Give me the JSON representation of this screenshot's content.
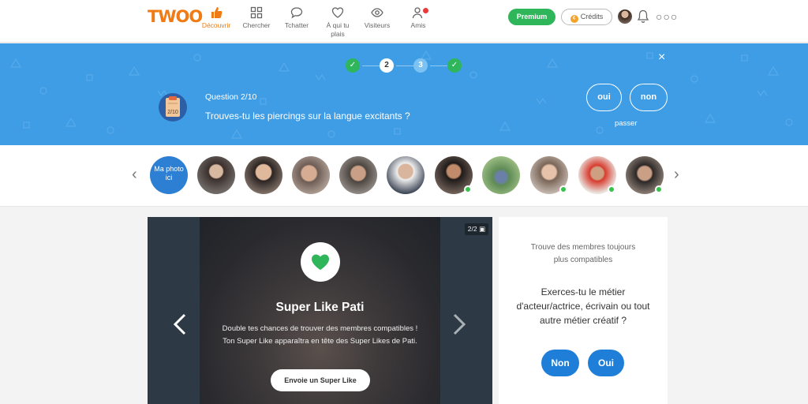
{
  "brand": {
    "logo": "TWOO",
    "accent": "#f07a13"
  },
  "nav": {
    "items": [
      {
        "label": "Découvrir",
        "icon": "thumbs-up-icon",
        "active": true
      },
      {
        "label": "Chercher",
        "icon": "grid-icon"
      },
      {
        "label": "Tchatter",
        "icon": "chat-bubble-icon"
      },
      {
        "label": "À qui tu plais",
        "icon": "heart-outline-icon"
      },
      {
        "label": "Visiteurs",
        "icon": "eye-icon"
      },
      {
        "label": "Amis",
        "icon": "friends-icon",
        "has_notification": true
      }
    ],
    "premium_label": "Premium",
    "credits_label": "Crédits",
    "more_label": "○○○"
  },
  "quiz": {
    "steps": [
      "✓",
      "2",
      "3",
      "✓"
    ],
    "question_label": "Question 2/10",
    "question_badge": "2/10",
    "question_text": "Trouves-tu les piercings sur la langue excitants ?",
    "yes_label": "oui",
    "no_label": "non",
    "skip_label": "passer",
    "close_label": "×"
  },
  "strip": {
    "my_photo_label": "Ma photo ici",
    "online_flags": [
      false,
      false,
      false,
      false,
      false,
      false,
      true,
      false,
      true,
      true,
      true
    ]
  },
  "card": {
    "photo_counter": "2/2",
    "title": "Super Like Pati",
    "description": "Double tes chances de trouver des membres compatibles ! Ton Super Like apparaîtra en tête des Super Likes de Pati.",
    "button_label": "Envoie un Super Like"
  },
  "side": {
    "intro": "Trouve des membres toujours plus compatibles",
    "question": "Exerces-tu le métier d'acteur/actrice, écrivain ou tout autre métier créatif ?",
    "no_label": "Non",
    "yes_label": "Oui"
  }
}
